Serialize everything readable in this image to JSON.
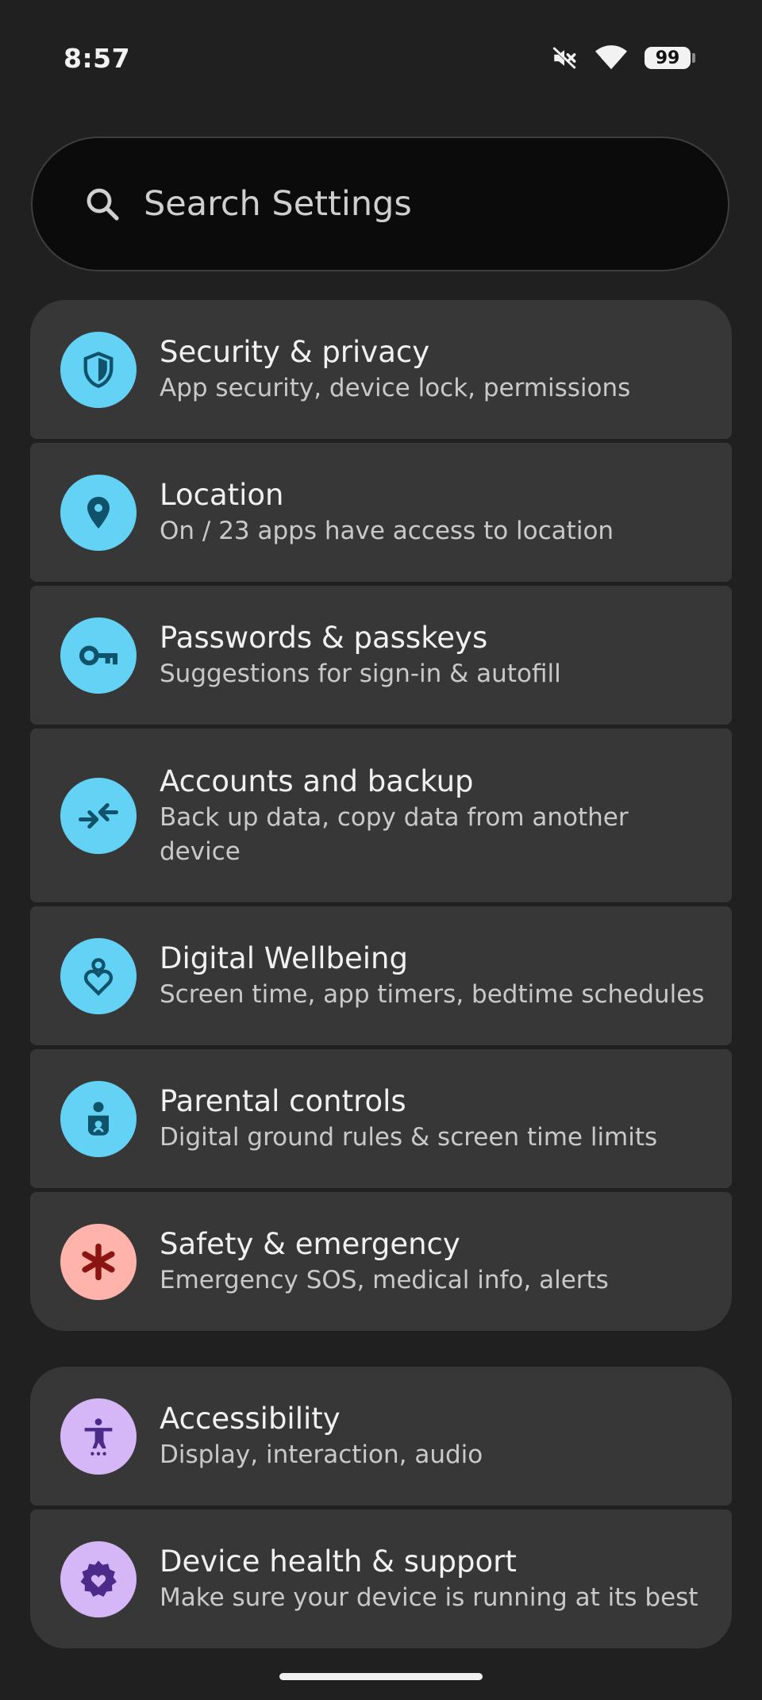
{
  "status_bar": {
    "time": "8:57",
    "battery": "99",
    "icons": [
      "mute-icon",
      "wifi-icon",
      "battery-icon"
    ]
  },
  "search": {
    "placeholder": "Search Settings"
  },
  "groups": [
    {
      "items": [
        {
          "title": "Security & privacy",
          "subtitle": "App security, device lock, permissions",
          "icon": "shield-icon",
          "icon_color": "#63d2f5"
        },
        {
          "title": "Location",
          "subtitle": "On / 23 apps have access to location",
          "icon": "location-pin-icon",
          "icon_color": "#63d2f5"
        },
        {
          "title": "Passwords & passkeys",
          "subtitle": "Suggestions for sign-in & autofill",
          "icon": "key-icon",
          "icon_color": "#63d2f5"
        },
        {
          "title": "Accounts and backup",
          "subtitle": "Back up data, copy data from another device",
          "icon": "sync-arrows-icon",
          "icon_color": "#63d2f5"
        },
        {
          "title": "Digital Wellbeing",
          "subtitle": "Screen time, app timers, bedtime schedules",
          "icon": "wellbeing-heart-icon",
          "icon_color": "#63d2f5"
        },
        {
          "title": "Parental controls",
          "subtitle": "Digital ground rules & screen time limits",
          "icon": "child-icon",
          "icon_color": "#63d2f5"
        },
        {
          "title": "Safety & emergency",
          "subtitle": "Emergency SOS, medical info, alerts",
          "icon": "asterisk-icon",
          "icon_color": "#ffb3ab"
        }
      ]
    },
    {
      "items": [
        {
          "title": "Accessibility",
          "subtitle": "Display, interaction, audio",
          "icon": "accessibility-icon",
          "icon_color": "#d5b6f7"
        },
        {
          "title": "Device health & support",
          "subtitle": "Make sure your device is running at its best",
          "icon": "gear-heart-icon",
          "icon_color": "#d5b6f7"
        }
      ]
    }
  ],
  "colors": {
    "background": "#202020",
    "card": "#373737",
    "blue_icon_fg": "#0f5269",
    "red_icon_fg": "#8a1410",
    "purple_icon_fg": "#4b2a8a"
  }
}
